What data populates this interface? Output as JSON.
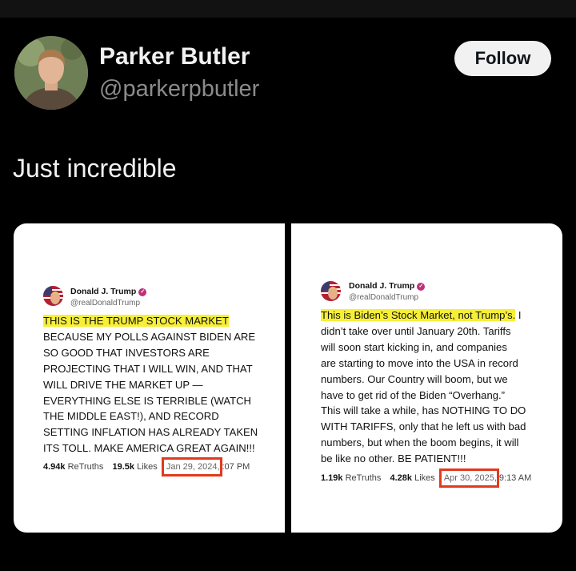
{
  "author": {
    "name": "Parker Butler",
    "handle": "@parkerpbutler",
    "follow_label": "Follow"
  },
  "post": {
    "text": "Just incredible"
  },
  "left_truth": {
    "name": "Donald J. Trump",
    "handle": "@realDonaldTrump",
    "highlight": "THIS IS THE TRUMP STOCK MARKET",
    "lines": [
      "BECAUSE MY POLLS AGAINST BIDEN ARE",
      "SO GOOD THAT INVESTORS ARE",
      "PROJECTING THAT I WILL WIN, AND THAT",
      "WILL DRIVE THE MARKET UP —",
      "EVERYTHING ELSE IS TERRIBLE (WATCH",
      "THE MIDDLE EAST!), AND RECORD",
      "SETTING INFLATION HAS ALREADY TAKEN",
      "ITS TOLL. MAKE AMERICA GREAT AGAIN!!!"
    ],
    "retruths_count": "4.94k",
    "retruths_label": "ReTruths",
    "likes_count": "19.5k",
    "likes_label": "Likes",
    "date": "Jan 29, 2024,",
    "time": ":07 PM"
  },
  "right_truth": {
    "name": "Donald J. Trump",
    "handle": "@realDonaldTrump",
    "highlight": "This is Biden’s Stock Market, not Trump’s.",
    "first_line_rest": " I",
    "lines": [
      "didn’t take over until January 20th. Tariffs",
      "will soon start kicking in, and companies",
      "are starting to move into the USA in record",
      "numbers. Our Country will boom, but we",
      "have to get rid of the Biden “Overhang.”",
      "This will take a while, has NOTHING TO DO",
      "WITH TARIFFS, only that he left us with bad",
      "numbers, but when the boom begins, it will",
      "be like no other. BE PATIENT!!!"
    ],
    "retruths_count": "1.19k",
    "retruths_label": "ReTruths",
    "likes_count": "4.28k",
    "likes_label": "Likes",
    "date": "Apr 30, 2025,",
    "time": "9:13 AM"
  },
  "colors": {
    "background": "#000000",
    "highlight": "#f7ef37",
    "annotation_box": "#e03a1f",
    "verified_badge": "#c0307a"
  }
}
